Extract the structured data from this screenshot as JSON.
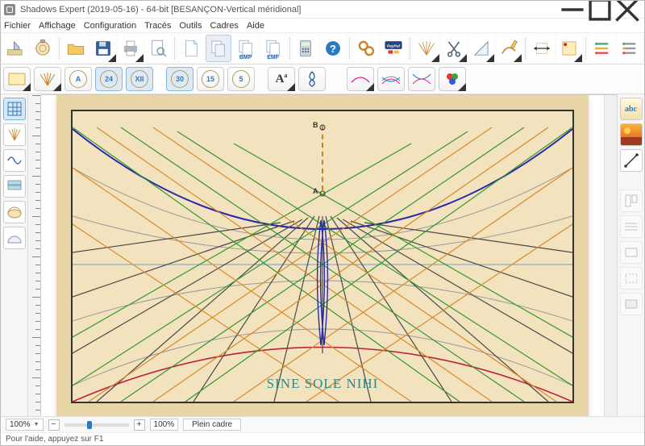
{
  "window": {
    "title": "Shadows Expert (2019-05-16) - 64-bit [BESANÇON-Vertical méridional]"
  },
  "menu": [
    "Fichier",
    "Affichage",
    "Configuration",
    "Tracés",
    "Outils",
    "Cadres",
    "Aide"
  ],
  "toolbar1": {
    "bmp": "BMP",
    "emf": "EMF"
  },
  "toolbar2": {
    "labels": [
      "A",
      "24",
      "XII",
      "30",
      "15",
      "5",
      "A"
    ]
  },
  "dial": {
    "motto": "SINE SOLE NIHI",
    "pointB": "B",
    "pointA": "A"
  },
  "status": {
    "zoom": "100%",
    "zoomAlt": "100%",
    "mode": "Plein cadre"
  },
  "helpbar": "Pour l'aide, appuyez sur F1",
  "colors": {
    "sheet": "#e8d5a8",
    "frame": "#f2e2bd"
  }
}
